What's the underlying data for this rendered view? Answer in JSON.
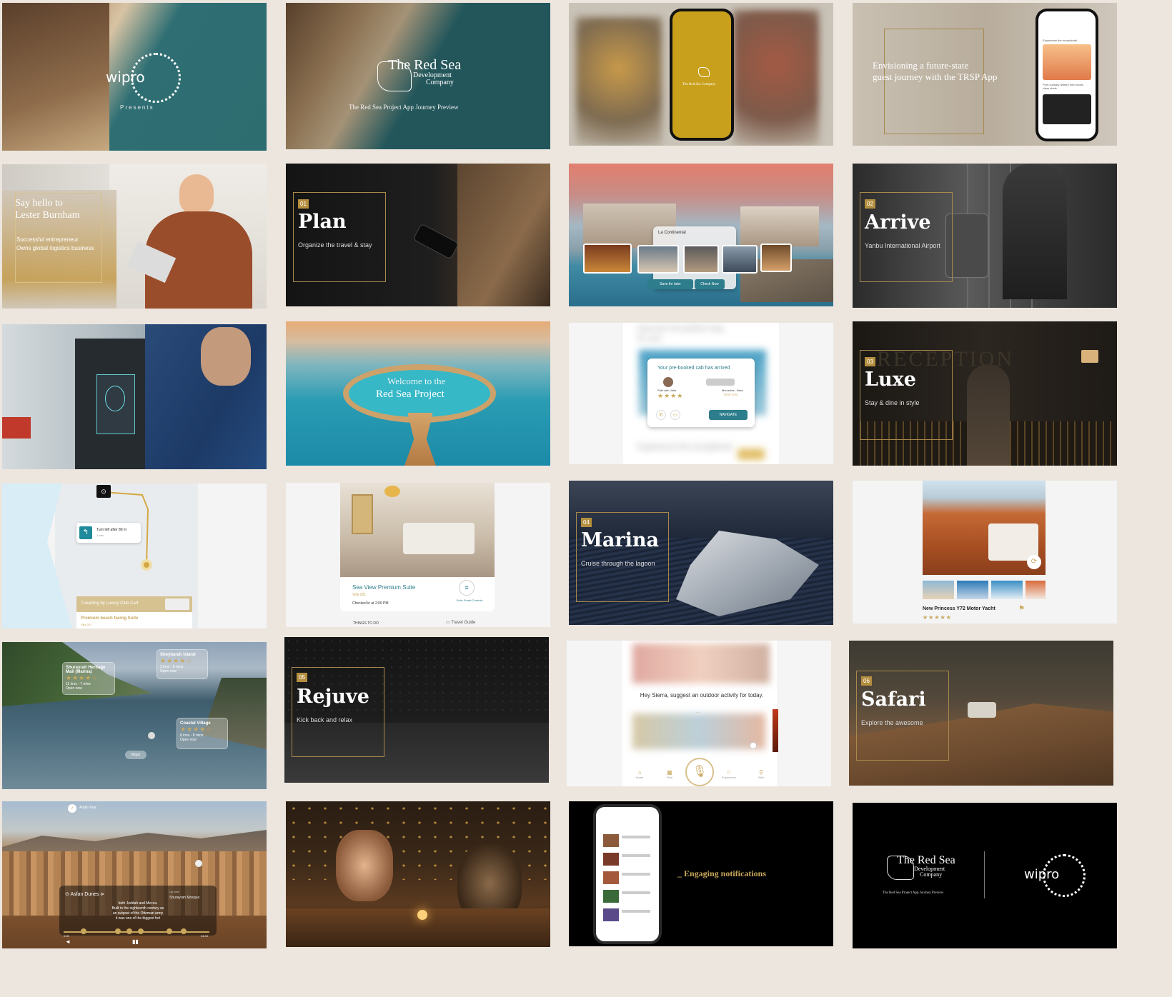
{
  "tiles": {
    "t1": {
      "logo": "wipro",
      "tagline": "Presents"
    },
    "t2": {
      "brand_line1": "The Red Sea",
      "brand_line2": "Development",
      "brand_line3": "Company",
      "caption": "The Red Sea Project App Journey Preview"
    },
    "t3": {
      "phone_label": "The Red Sea Company"
    },
    "t4": {
      "headline_line1": "Envisioning a future-state",
      "headline_line2": "guest journey with the TRSP App",
      "phone_text1": "Experience the exceptional",
      "phone_text2": "Pure culinary artistry from world-class chefs"
    },
    "t5": {
      "headline_line1": "Say hello to",
      "headline_line2": "Lester Burnham",
      "bullet1": "Successful entrepreneur",
      "bullet2": "Owns global logistics business"
    },
    "t6": {
      "number": "01",
      "title": "Plan",
      "subtitle": "Organize the travel & stay"
    },
    "t7": {
      "place": "La Continental",
      "save_label": "Save for later",
      "book_label": "Check Now"
    },
    "t8": {
      "number": "02",
      "title": "Arrive",
      "subtitle": "Yanbu International Airport"
    },
    "t10": {
      "welcome": "Welcome to the",
      "project": "Red Sea Project"
    },
    "t11": {
      "blur_top_line1": "Discover the perfect stay",
      "blur_top_line2": "for you",
      "card_title": "Your pre-booked cab has arrived",
      "driver": "Ride with Jafar",
      "car": "Mercedes - Benz",
      "plate": "TRSP 8790",
      "navigate": "NAVIGATE",
      "blur_bottom": "Experience the exceptional"
    },
    "t12": {
      "number": "03",
      "bg_word": "RECEPTION",
      "title": "Luxe",
      "subtitle": "Stay & dine in style"
    },
    "t13": {
      "instruction": "Turn left after 80 m",
      "sub": "1 min",
      "banner": "Travelling by Luxury Club Cart",
      "destination": "Premium beach facing Suite",
      "villa": "Villa 201"
    },
    "t14": {
      "suite": "Sea View Premium Suite",
      "villa": "Villa 201",
      "checkin": "Checked in at 2:00 PM",
      "controls": "Suite Smart Controls",
      "things": "THINGS TO DO",
      "guide": "Travel Guide"
    },
    "t15": {
      "number": "04",
      "title": "Marina",
      "subtitle": "Cruise through the lagoon"
    },
    "t16": {
      "yacht": "New Princess Y72 Motor Yacht",
      "stars": "★★★★★"
    },
    "t17": {
      "poi1_name": "Sheybarah Island",
      "poi1_meta1": "3 kms - 6 mins",
      "poi1_meta2": "Open now",
      "poi2_name": "Shurayrah Heritage Mall (Marina)",
      "poi2_meta1": "11 kms - 7 mins",
      "poi2_meta2": "Open now",
      "poi3_name": "Coastal Village",
      "poi3_meta1": "8 kms - 8 mins",
      "poi3_meta2": "Open now",
      "maps_label": "Maps",
      "stars": "★★★★☆"
    },
    "t18": {
      "number": "05",
      "title": "Rejuve",
      "subtitle": "Kick back and relax"
    },
    "t19": {
      "prompt": "Hey Sierra, suggest an outdoor activity for today.",
      "dots": "...",
      "nav_home": "Home",
      "nav_plan": "Plan",
      "nav_experience": "Experience",
      "nav_ride": "Ride"
    },
    "t20": {
      "number": "06",
      "title": "Safari",
      "subtitle": "Explore the awesome"
    },
    "t21": {
      "audio": "Audio Tour",
      "place": "Asfan Dunes",
      "up_next_label": "Up next",
      "up_next": "Shurayrah Mosque",
      "desc1": "both Jeddah and Mecca.",
      "desc2": "Built in the eighteenth century as",
      "desc3": "an outpost of the Ottoman army",
      "desc4": "it was one of the biggest fort",
      "time_start": "0:00",
      "time_end": "04:00"
    },
    "t23": {
      "headline": "_ Engaging notifications"
    },
    "t24": {
      "brand_line1": "The Red Sea",
      "brand_line2": "Development",
      "brand_line3": "Company",
      "caption": "The Red Sea Project App Journey Preview",
      "logo": "wipro"
    }
  },
  "colors": {
    "background": "#ece6df",
    "gold": "#c9a85c",
    "phone_yellow": "#c9a01c",
    "teal": "#1f8a9b"
  }
}
